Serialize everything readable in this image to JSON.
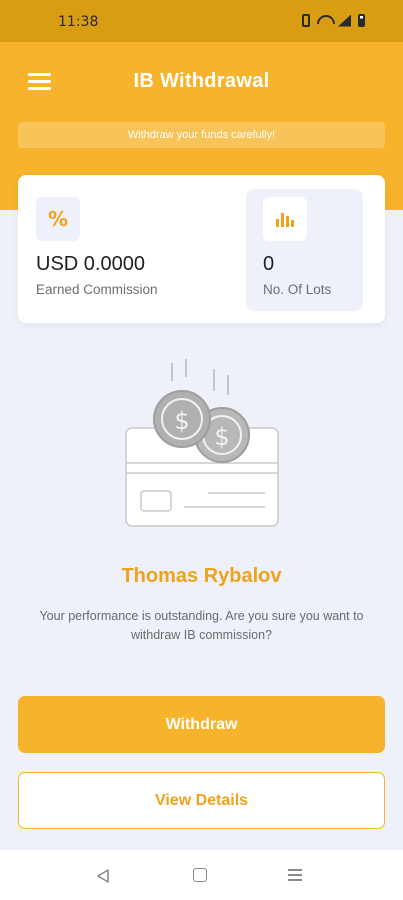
{
  "status_bar": {
    "time": "11:38"
  },
  "header": {
    "title": "IB Withdrawal",
    "notice": "Withdraw your funds carefully!"
  },
  "stats": {
    "commission": {
      "icon": "percent-icon",
      "glyph": "%",
      "value": "USD 0.0000",
      "label": "Earned Commission"
    },
    "lots": {
      "icon": "bar-chart-icon",
      "value": "0",
      "label": "No. Of Lots"
    }
  },
  "user": {
    "name": "Thomas Rybalov",
    "message": "Your performance is outstanding. Are you sure you want to withdraw IB commission?"
  },
  "actions": {
    "withdraw_label": "Withdraw",
    "details_label": "View Details"
  },
  "colors": {
    "status_bar": "#d99d14",
    "accent": "#f6b32b",
    "accent_text": "#f0a21c",
    "background": "#eef1fa"
  }
}
